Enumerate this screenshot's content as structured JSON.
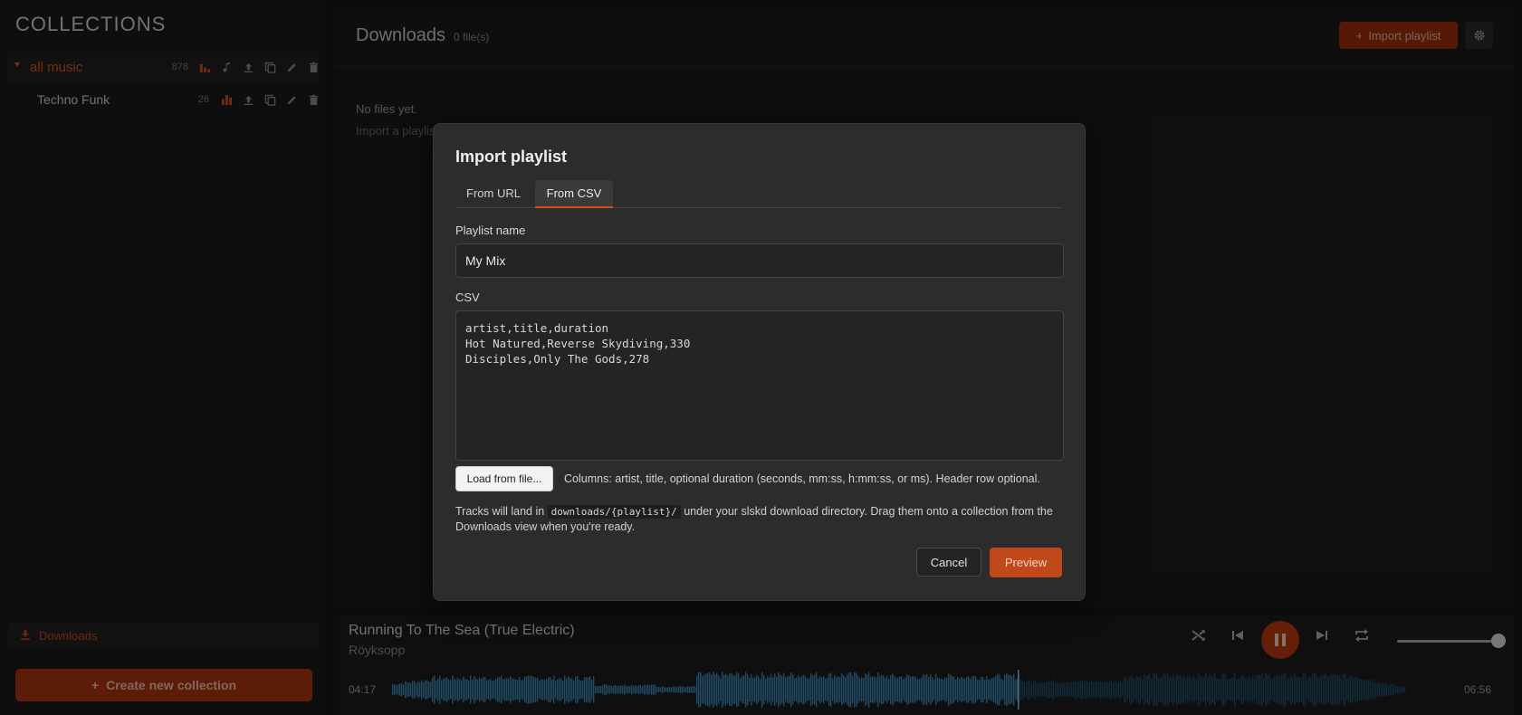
{
  "sidebar": {
    "title": "COLLECTIONS",
    "collections": [
      {
        "name": "all music",
        "count": "878"
      },
      {
        "name": "Techno Funk",
        "count": "26"
      }
    ],
    "downloads_label": "Downloads",
    "create_label": "Create new collection"
  },
  "main": {
    "title": "Downloads",
    "file_count": "0 file(s)",
    "import_label": "Import playlist",
    "empty_line1": "No files yet.",
    "empty_line2": "Import a playlist"
  },
  "modal": {
    "title": "Import playlist",
    "tabs": [
      {
        "label": "From URL",
        "active": false
      },
      {
        "label": "From CSV",
        "active": true
      }
    ],
    "name_label": "Playlist name",
    "name_value": "My Mix",
    "csv_label": "CSV",
    "csv_value": "artist,title,duration\nHot Natured,Reverse Skydiving,330\nDisciples,Only The Gods,278",
    "load_label": "Load from file...",
    "columns_hint": "Columns: artist, title, optional duration (seconds, mm:ss, h:mm:ss, or ms). Header row optional.",
    "note_before": "Tracks will land in ",
    "note_code": "downloads/{playlist}/",
    "note_after": " under your slskd download directory. Drag them onto a collection from the Downloads view when you're ready.",
    "cancel_label": "Cancel",
    "preview_label": "Preview"
  },
  "player": {
    "title": "Running To The Sea (True Electric)",
    "artist": "Röyksopp",
    "current_time": "04:17",
    "total_time": "06:56",
    "progress": 0.617,
    "volume": 0.93
  },
  "colors": {
    "accent": "#d0501c",
    "accent_dark": "#9c2e0b",
    "waveform_played": "#3d86b3",
    "waveform_unplayed": "#1f4a63"
  }
}
